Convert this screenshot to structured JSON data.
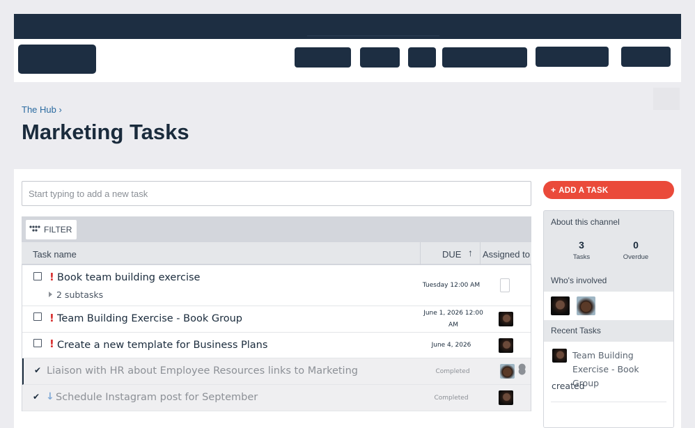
{
  "breadcrumb": "The Hub ›",
  "page_title": "Marketing Tasks",
  "task_input": {
    "placeholder": "Start typing to add a new task"
  },
  "filter": {
    "label": "FILTER",
    "icon": "filter-dots-icon"
  },
  "table": {
    "headers": {
      "name": "Task name",
      "due": "DUE",
      "sort_icon": "↑",
      "assigned": "Assigned to"
    },
    "rows": [
      {
        "title": "Book team building exercise",
        "priority": "!",
        "subtasks": "2 subtasks",
        "due": "Tuesday 12:00 AM",
        "completed": false
      },
      {
        "title": "Team Building Exercise - Book Group",
        "priority": "!",
        "due": "June 1, 2026 12:00 AM",
        "completed": false
      },
      {
        "title": "Create a new template for Business Plans",
        "priority": "!",
        "due": "June 4, 2026",
        "completed": false
      },
      {
        "title": "Liaison with HR about Employee Resources links to Marketing",
        "checkmark": "✔",
        "due": "Completed",
        "completed": true
      },
      {
        "title": "Schedule Instagram post for September",
        "checkmark": "✔",
        "priority_low": "↓",
        "due": "Completed",
        "completed": true
      }
    ]
  },
  "sidebar": {
    "add_task": {
      "icon": "+",
      "label": "ADD A TASK"
    },
    "about_title": "About this channel",
    "stats": [
      {
        "value": "3",
        "label": "Tasks"
      },
      {
        "value": "0",
        "label": "Overdue"
      }
    ],
    "who_involved": "Who's involved",
    "recent_tasks": "Recent Tasks",
    "recent": {
      "title": "Team Building Exercise - Book Group",
      "action": "created"
    }
  },
  "colors": {
    "navy": "#1d2e42",
    "accent": "#ea4a3a",
    "priority": "#d62b2b",
    "link": "#2a6aa0"
  }
}
